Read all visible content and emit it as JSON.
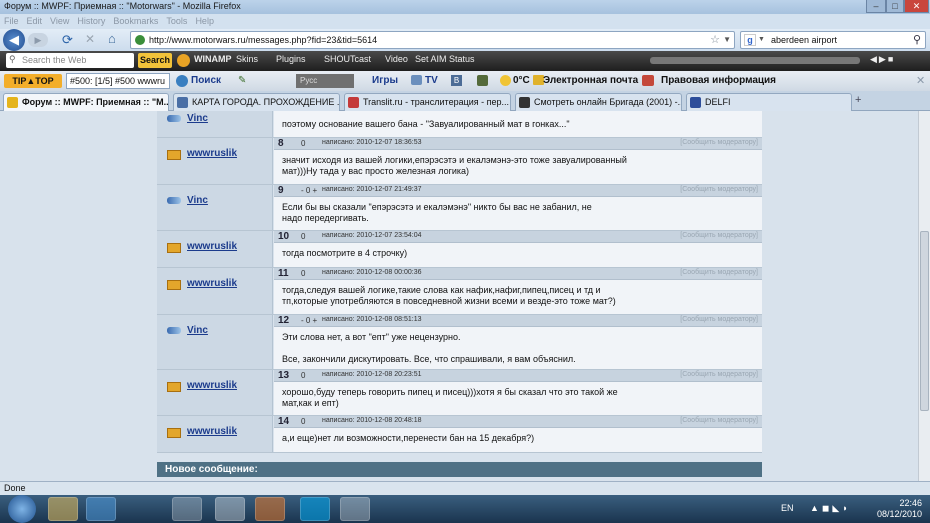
{
  "window": {
    "title": "Форум :: MWPF: Приемная :: \"Motorwars\" - Mozilla Firefox"
  },
  "menu": [
    "File",
    "Edit",
    "View",
    "History",
    "Bookmarks",
    "Tools",
    "Help"
  ],
  "nav": {
    "url": "http://www.motorwars.ru/messages.php?fid=23&tid=5614",
    "search_value": "aberdeen airport"
  },
  "toolbar1": {
    "search_placeholder": "Search the Web",
    "search_button": "Search",
    "winamp": "WINAMP",
    "skins": "Skins",
    "plugins": "Plugins",
    "shoutcast": "SHOUTcast",
    "video": "Video",
    "aim": "Set AIM Status"
  },
  "toolbar2": {
    "select_value": "#500: [1/5] #500 wwwru",
    "search": "Поиск",
    "rus": "Русс",
    "games": "Игры",
    "tv": "TV",
    "temp": "0°C",
    "email": "Электронная почта",
    "legal": "Правовая информация"
  },
  "tabs": [
    {
      "label": "Форум :: MWPF: Приемная :: \"M...",
      "color": "#e5b41c"
    },
    {
      "label": "КАРТА ГОРОДА. ПРОХОЖДЕНИЕ ...",
      "color": "#4a6fa6"
    },
    {
      "label": "Translit.ru - транслитерация - пер...",
      "color": "#c43a3a"
    },
    {
      "label": "Смотреть онлайн Бригада (2001) -...",
      "color": "#333333"
    },
    {
      "label": "DELFI",
      "color": "#2d4d9a"
    }
  ],
  "posts": [
    {
      "num": "",
      "rate": "",
      "date": "",
      "author": "Vinc",
      "av": "vinc",
      "lines": [
        "поэтому основание вашего бана - \"Завуалированный мат в гонках...\""
      ]
    },
    {
      "num": "8",
      "rate": "0",
      "date": "написано: 2010-12-07 18:36:53",
      "author": "wwwruslik",
      "av": "ruslik",
      "lines": [
        "значит исходя из вашей логики,епэрэсэтэ и екалэмэнэ-это тоже завуалированный",
        "мат)))Ну тада у вас просто железная логика)"
      ]
    },
    {
      "num": "9",
      "rate": "- 0 +",
      "date": "написано: 2010-12-07 21:49:37",
      "author": "Vinc",
      "av": "vinc",
      "lines": [
        "Если бы вы сказали \"епэрэсэтэ и екалэмэнэ\" никто бы вас не забанил, не",
        "надо передергивать."
      ]
    },
    {
      "num": "10",
      "rate": "0",
      "date": "написано: 2010-12-07 23:54:04",
      "author": "wwwruslik",
      "av": "ruslik",
      "lines": [
        "тогда посмотрите в 4 строчку)"
      ]
    },
    {
      "num": "11",
      "rate": "0",
      "date": "написано: 2010-12-08 00:00:36",
      "author": "wwwruslik",
      "av": "ruslik",
      "lines": [
        "тогда,следуя вашей логике,такие слова как нафик,нафиг,пипец,писец и тд и",
        "тп,которые употребляются в повседневной жизни всеми и везде-это тоже мат?)"
      ]
    },
    {
      "num": "12",
      "rate": "- 0 +",
      "date": "написано: 2010-12-08 08:51:13",
      "author": "Vinc",
      "av": "vinc",
      "lines": [
        "Эти слова нет, а вот \"епт\" уже нецензурно.",
        "",
        "Все, закончили дискутировать. Все, что спрашивали, я вам объяснил."
      ]
    },
    {
      "num": "13",
      "rate": "0",
      "date": "написано: 2010-12-08 20:23:51",
      "author": "wwwruslik",
      "av": "ruslik",
      "lines": [
        "хорошо,буду теперь говорить пипец и писец)))хотя я бы сказал что это такой же",
        "мат,как и епт)"
      ]
    },
    {
      "num": "14",
      "rate": "0",
      "date": "написано: 2010-12-08 20:48:18",
      "author": "wwwruslik",
      "av": "ruslik",
      "lines": [
        "а,и еще)нет ли возможности,перенести бан на 15 декабря?)"
      ]
    }
  ],
  "report_label": "[Сообщить модератору]",
  "new_message": "Новое сообщение:",
  "status": "Done",
  "tray": {
    "lang": "EN",
    "time": "22:46",
    "date": "08/12/2010"
  }
}
